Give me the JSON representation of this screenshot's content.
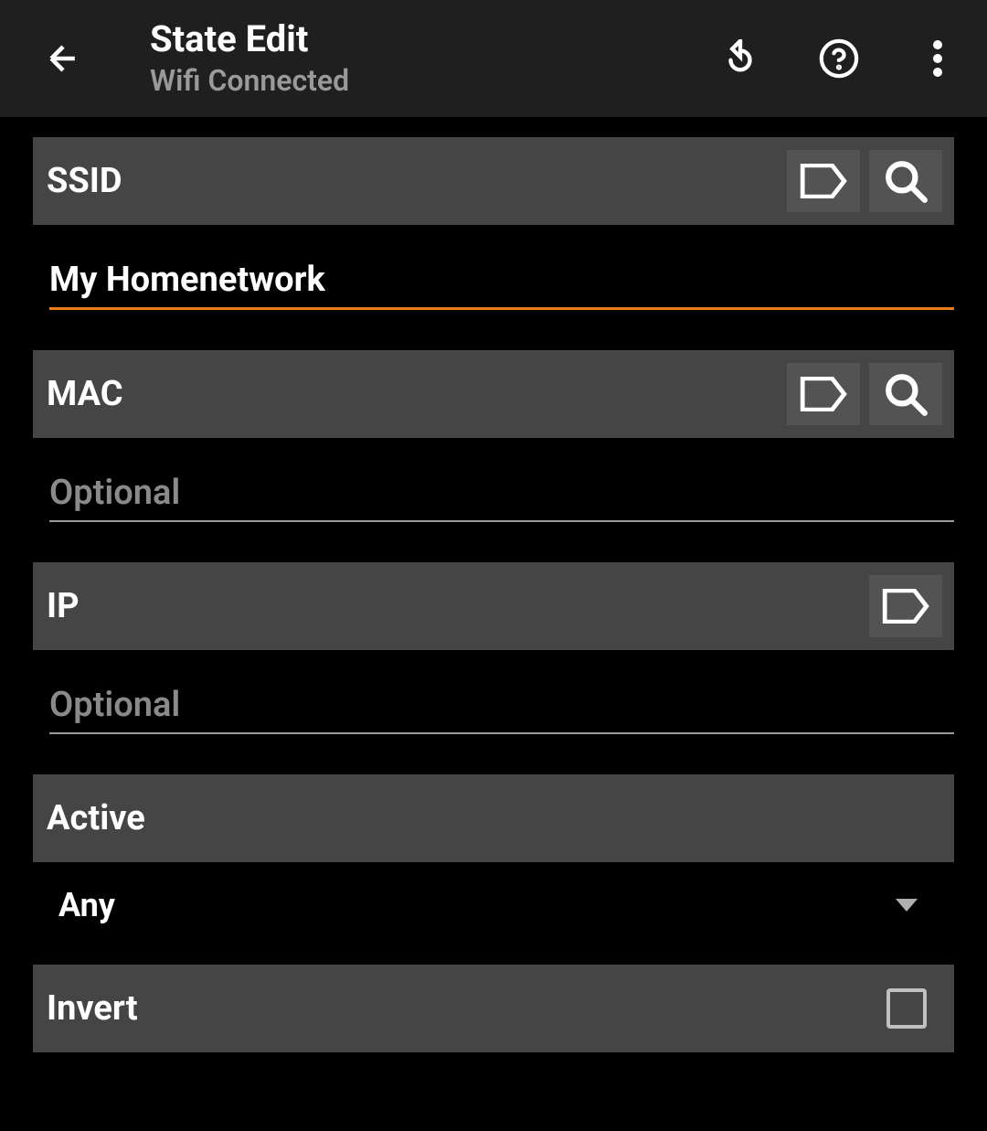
{
  "header": {
    "title": "State Edit",
    "subtitle": "Wifi Connected"
  },
  "sections": {
    "ssid": {
      "label": "SSID",
      "value": "My Homenetwork"
    },
    "mac": {
      "label": "MAC",
      "value": "",
      "placeholder": "Optional"
    },
    "ip": {
      "label": "IP",
      "value": "",
      "placeholder": "Optional"
    },
    "active": {
      "label": "Active",
      "selected": "Any"
    },
    "invert": {
      "label": "Invert",
      "checked": false
    }
  }
}
